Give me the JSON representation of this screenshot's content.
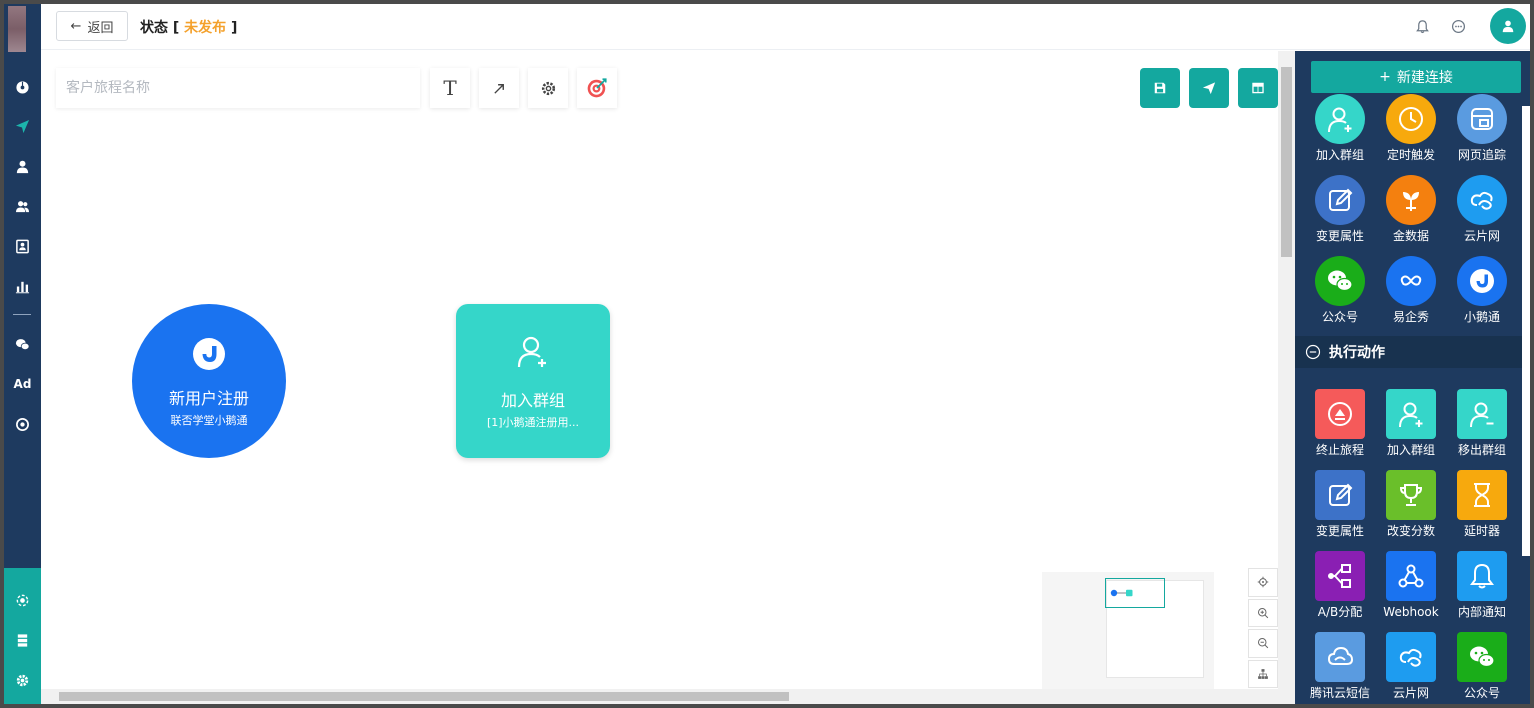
{
  "topbar": {
    "back_label": "返回",
    "status_label": "状态",
    "status_value": "未发布"
  },
  "toolbar": {
    "name_placeholder": "客户旅程名称",
    "text_tool": "T"
  },
  "rail": {
    "ad_label": "Ad"
  },
  "canvas": {
    "trigger_node": {
      "title": "新用户注册",
      "subtitle": "联否学堂小鹅通"
    },
    "action_node": {
      "title": "加入群组",
      "subtitle": "[1]小鹅通注册用..."
    }
  },
  "panel": {
    "new_connection_label": "新建连接",
    "triggers": [
      {
        "label": "加入群组",
        "color": "#35d6c9",
        "icon": "user-plus-icon"
      },
      {
        "label": "定时触发",
        "color": "#f7a90d",
        "icon": "clock-icon"
      },
      {
        "label": "网页追踪",
        "color": "#5a9be0",
        "icon": "web-track-icon"
      },
      {
        "label": "变更属性",
        "color": "#3d72c8",
        "icon": "edit-icon"
      },
      {
        "label": "金数据",
        "color": "#f4800f",
        "icon": "jinshuju-icon"
      },
      {
        "label": "云片网",
        "color": "#1e9cf0",
        "icon": "cloud-link-icon"
      },
      {
        "label": "公众号",
        "color": "#1aad19",
        "icon": "wechat-icon"
      },
      {
        "label": "易企秀",
        "color": "#1a73f0",
        "icon": "infinity-icon"
      },
      {
        "label": "小鹅通",
        "color": "#1a73f0",
        "icon": "goose-icon"
      }
    ],
    "actions_section_title": "执行动作",
    "actions": [
      {
        "label": "终止旅程",
        "color": "#f55a5a",
        "icon": "stop-icon"
      },
      {
        "label": "加入群组",
        "color": "#35d6c9",
        "icon": "user-plus-icon"
      },
      {
        "label": "移出群组",
        "color": "#35d6c9",
        "icon": "user-minus-icon"
      },
      {
        "label": "变更属性",
        "color": "#3d72c8",
        "icon": "edit-icon"
      },
      {
        "label": "改变分数",
        "color": "#6abf2a",
        "icon": "trophy-icon"
      },
      {
        "label": "延时器",
        "color": "#f7a90d",
        "icon": "hourglass-icon"
      },
      {
        "label": "A/B分配",
        "color": "#8a1fb3",
        "icon": "split-icon"
      },
      {
        "label": "Webhook",
        "color": "#1a73f0",
        "icon": "webhook-icon"
      },
      {
        "label": "内部通知",
        "color": "#1e9cf0",
        "icon": "bell-icon"
      },
      {
        "label": "腾讯云短信",
        "color": "#5a9be0",
        "icon": "tencent-cloud-icon"
      },
      {
        "label": "云片网",
        "color": "#1e9cf0",
        "icon": "cloud-link-icon"
      },
      {
        "label": "公众号",
        "color": "#1aad19",
        "icon": "wechat-icon"
      }
    ]
  }
}
